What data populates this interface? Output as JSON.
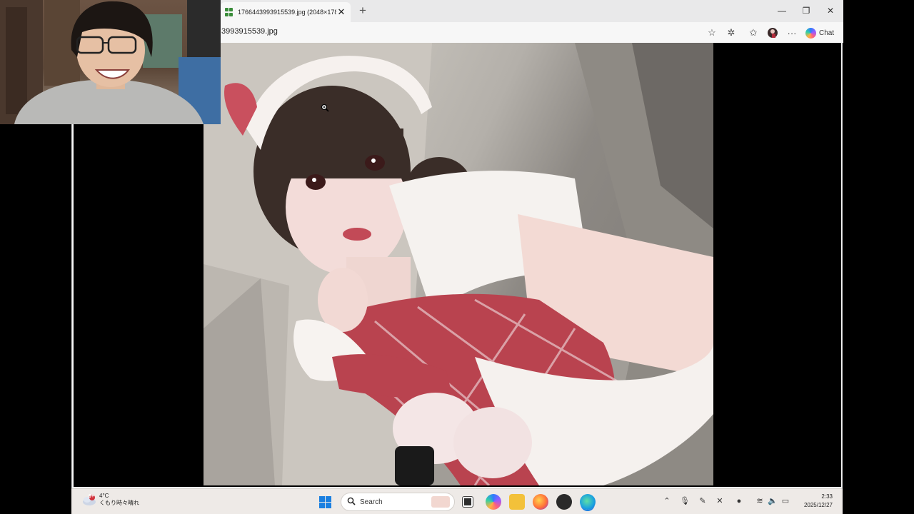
{
  "browser": {
    "tab_title": "1766443993915539.jpg (2048×178",
    "url_text": "3993915539.jpg",
    "chat_label": "Chat"
  },
  "taskbar": {
    "weather_temp": "4°C",
    "weather_desc": "くもり時々晴れ",
    "weather_badge": "9+",
    "search_label": "Search",
    "time": "2:33",
    "date": "2025/12/27"
  },
  "icons": [
    "tab-favicon-icon",
    "close-icon",
    "new-tab-icon",
    "minimize-icon",
    "restore-icon",
    "star-icon",
    "extensions-icon",
    "favorites-icon",
    "more-icon",
    "copilot-icon",
    "zoom-cursor-icon",
    "windows-start-icon",
    "search-icon",
    "file-explorer-icon",
    "browser-icon",
    "microphone-icon",
    "pen-icon",
    "wifi-icon",
    "volume-icon",
    "battery-icon"
  ],
  "colors": {
    "taskbar_bg": "#eeeae7",
    "tab_bar_bg": "#e9e9ea",
    "start_blue": "#1a7fe0"
  }
}
